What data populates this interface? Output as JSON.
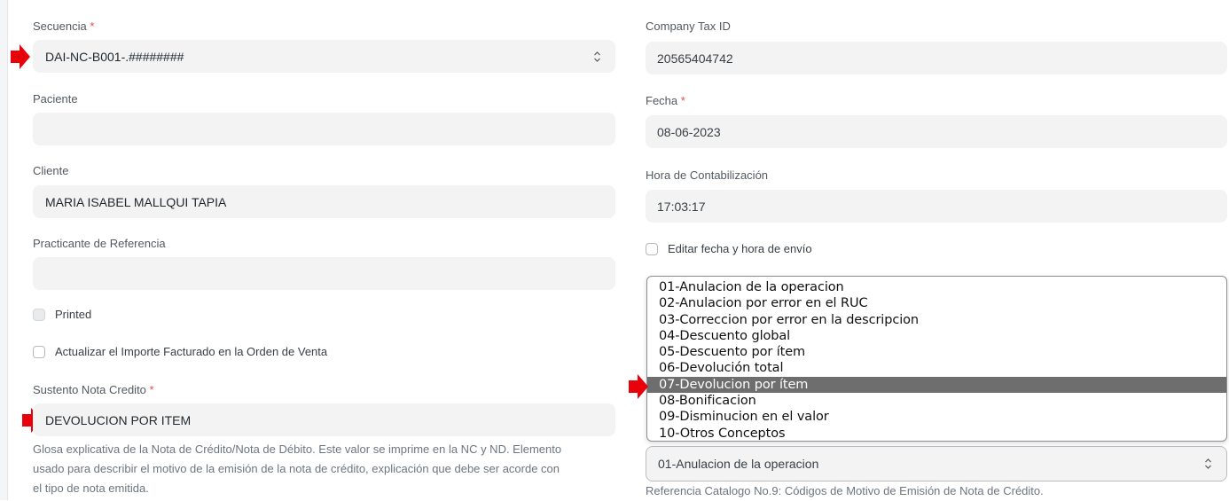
{
  "left": {
    "secuencia": {
      "label": "Secuencia",
      "required": "*",
      "value": "DAI-NC-B001-.########"
    },
    "paciente": {
      "label": "Paciente",
      "value": ""
    },
    "cliente": {
      "label": "Cliente",
      "value": "MARIA ISABEL MALLQUI TAPIA"
    },
    "practicante": {
      "label": "Practicante de Referencia",
      "value": ""
    },
    "printed": {
      "label": "Printed"
    },
    "actualizar": {
      "label": "Actualizar el Importe Facturado en la Orden de Venta"
    },
    "sustento": {
      "label": "Sustento Nota Credito",
      "required": "*",
      "value": "DEVOLUCION POR ITEM",
      "help_line1": "Glosa explicativa de la Nota de Crédito/Nota de Débito. Este valor se imprime en la NC y ND. Elemento",
      "help_line2": "usado para describir el motivo de la emisión de la nota de crédito, explicación que debe ser acorde con",
      "help_line3": "el tipo de nota emitida."
    }
  },
  "right": {
    "company_tax": {
      "label": "Company Tax ID",
      "value": "20565404742"
    },
    "fecha": {
      "label": "Fecha",
      "required": "*",
      "value": "08-06-2023"
    },
    "hora": {
      "label": "Hora de Contabilización",
      "value": "17:03:17"
    },
    "editar": {
      "label": "Editar fecha y hora de envío"
    },
    "motivo": {
      "value": "01-Anulacion de la operacion",
      "help": "Referencia Catalogo No.9: Códigos de Motivo de Emisión de Nota de Crédito.",
      "options": [
        "01-Anulacion de la operacion",
        "02-Anulacion por error en el RUC",
        "03-Correccion por error en la descripcion",
        "04-Descuento global",
        "05-Descuento por ítem",
        "06-Devolución total",
        "07-Devolucion por ítem",
        "08-Bonificacion",
        "09-Disminucion en el valor",
        "10-Otros Conceptos"
      ],
      "highlighted_index": 6
    }
  },
  "colors": {
    "arrow": "#e8000b",
    "required": "#e24c4c",
    "selected_option_bg": "#6e6e6e"
  }
}
